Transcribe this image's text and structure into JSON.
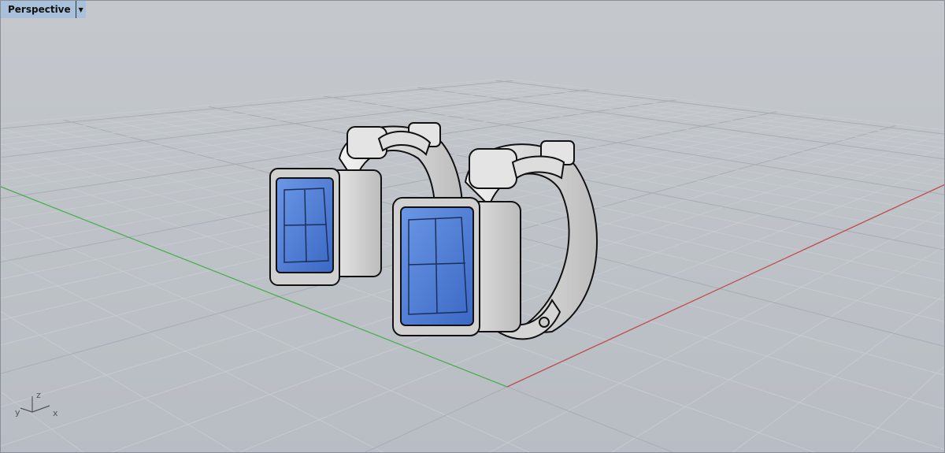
{
  "viewport": {
    "title": "Perspective",
    "menu_icon": "dropdown-arrow-icon",
    "axis_labels": {
      "x": "x",
      "y": "y",
      "z": "z"
    }
  },
  "colors": {
    "background": "#bcc1c7",
    "grid_minor": "#c9cdd2",
    "grid_major": "#a9aeb5",
    "x_axis": "#c0504d",
    "y_axis": "#4caf50",
    "gem": "#4d7fd6",
    "metal": "#e6e6e6"
  }
}
